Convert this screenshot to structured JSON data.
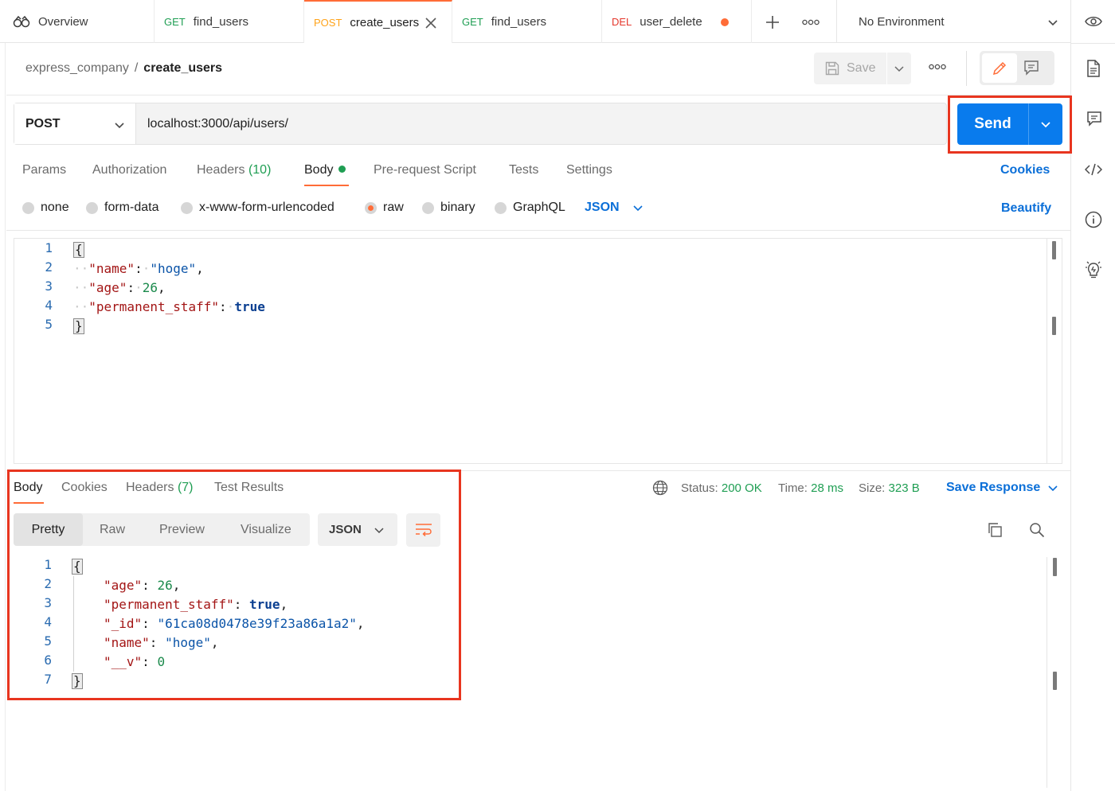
{
  "tabs": [
    {
      "method": "",
      "label": "Overview"
    },
    {
      "method": "GET",
      "label": "find_users"
    },
    {
      "method": "POST",
      "label": "create_users"
    },
    {
      "method": "GET",
      "label": "find_users"
    },
    {
      "method": "DEL",
      "label": "user_delete"
    }
  ],
  "environment": "No Environment",
  "breadcrumb": {
    "workspace": "express_company",
    "separator": "/",
    "current": "create_users"
  },
  "header": {
    "save_label": "Save"
  },
  "request": {
    "method": "POST",
    "url": "localhost:3000/api/users/",
    "send_label": "Send",
    "tabs": {
      "params": "Params",
      "authorization": "Authorization",
      "headers": "Headers",
      "headers_count": "(10)",
      "body": "Body",
      "prerequest": "Pre-request Script",
      "tests": "Tests",
      "settings": "Settings"
    },
    "cookies_label": "Cookies",
    "body_modes": [
      "none",
      "form-data",
      "x-www-form-urlencoded",
      "raw",
      "binary",
      "GraphQL"
    ],
    "selected_mode": "raw",
    "format": "JSON",
    "beautify_label": "Beautify",
    "line_numbers": [
      "1",
      "2",
      "3",
      "4",
      "5"
    ],
    "body_lines": {
      "open": "{",
      "l2_key": "\"name\"",
      "l2_val": "\"hoge\"",
      "l3_key": "\"age\"",
      "l3_val": "26",
      "l4_key": "\"permanent_staff\"",
      "l4_val": "true",
      "close": "}"
    }
  },
  "response": {
    "tabs": {
      "body": "Body",
      "cookies": "Cookies",
      "headers": "Headers",
      "headers_count": "(7)",
      "tests": "Test Results"
    },
    "status_label": "Status:",
    "status": "200 OK",
    "time_label": "Time:",
    "time": "28 ms",
    "size_label": "Size:",
    "size": "323 B",
    "save_response_label": "Save Response",
    "views": [
      "Pretty",
      "Raw",
      "Preview",
      "Visualize"
    ],
    "selected_view": "Pretty",
    "format": "JSON",
    "line_numbers": [
      "1",
      "2",
      "3",
      "4",
      "5",
      "6",
      "7"
    ],
    "body_lines": {
      "open": "{",
      "l2_key": "\"age\"",
      "l2_val": "26",
      "l3_key": "\"permanent_staff\"",
      "l3_val": "true",
      "l4_key": "\"_id\"",
      "l4_val": "\"61ca08d0478e39f23a86a1a2\"",
      "l5_key": "\"name\"",
      "l5_val": "\"hoge\"",
      "l6_key": "\"__v\"",
      "l6_val": "0",
      "close": "}"
    }
  },
  "colors": {
    "accent": "#ff6c37",
    "send": "#097bed",
    "highlight_box": "#e8351f",
    "method_get": "#1f9e53",
    "method_post": "#ffa31a",
    "method_del": "#e5372c",
    "status_ok": "#1f9e53",
    "link": "#0b6fd8"
  },
  "icons": [
    "overview-icon",
    "close-icon",
    "unsaved-dot",
    "plus-icon",
    "more-icon",
    "chevron-down-icon",
    "eye-icon",
    "document-icon",
    "comment-icon",
    "code-icon",
    "info-icon",
    "lightbulb-icon",
    "save-icon",
    "pencil-icon",
    "globe-icon",
    "wrap-lines-icon",
    "copy-icon",
    "search-icon"
  ]
}
